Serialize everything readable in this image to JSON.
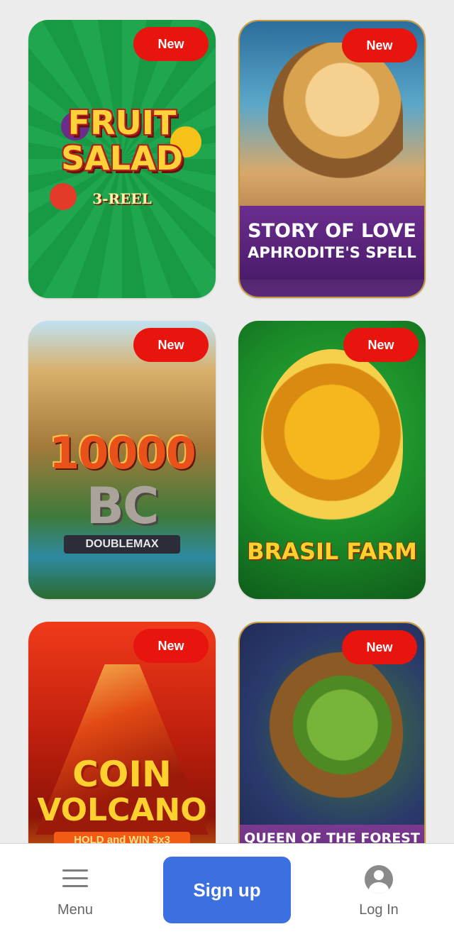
{
  "games": [
    {
      "title": "FRUIT SALAD",
      "subtitle": "3-REEL",
      "badge": "New"
    },
    {
      "title_line1": "STORY OF LOVE",
      "title_line2": "APHRODITE'S SPELL",
      "badge": "New"
    },
    {
      "title_line1": "10000",
      "title_line2": "BC",
      "subtitle": "DOUBLEMAX",
      "badge": "New"
    },
    {
      "title": "BRASIL FARM",
      "badge": "New"
    },
    {
      "title_line1": "COIN",
      "title_line2": "VOLCANO",
      "subtitle": "HOLD and WIN 3x3",
      "badge": "New"
    },
    {
      "title": "QUEEN OF THE FOREST",
      "badge": "New"
    }
  ],
  "bottom_bar": {
    "menu_label": "Menu",
    "signup_label": "Sign up",
    "login_label": "Log In"
  },
  "colors": {
    "badge": "#e8140e",
    "signup_button": "#3c6fe0",
    "page_background": "#ececec"
  }
}
